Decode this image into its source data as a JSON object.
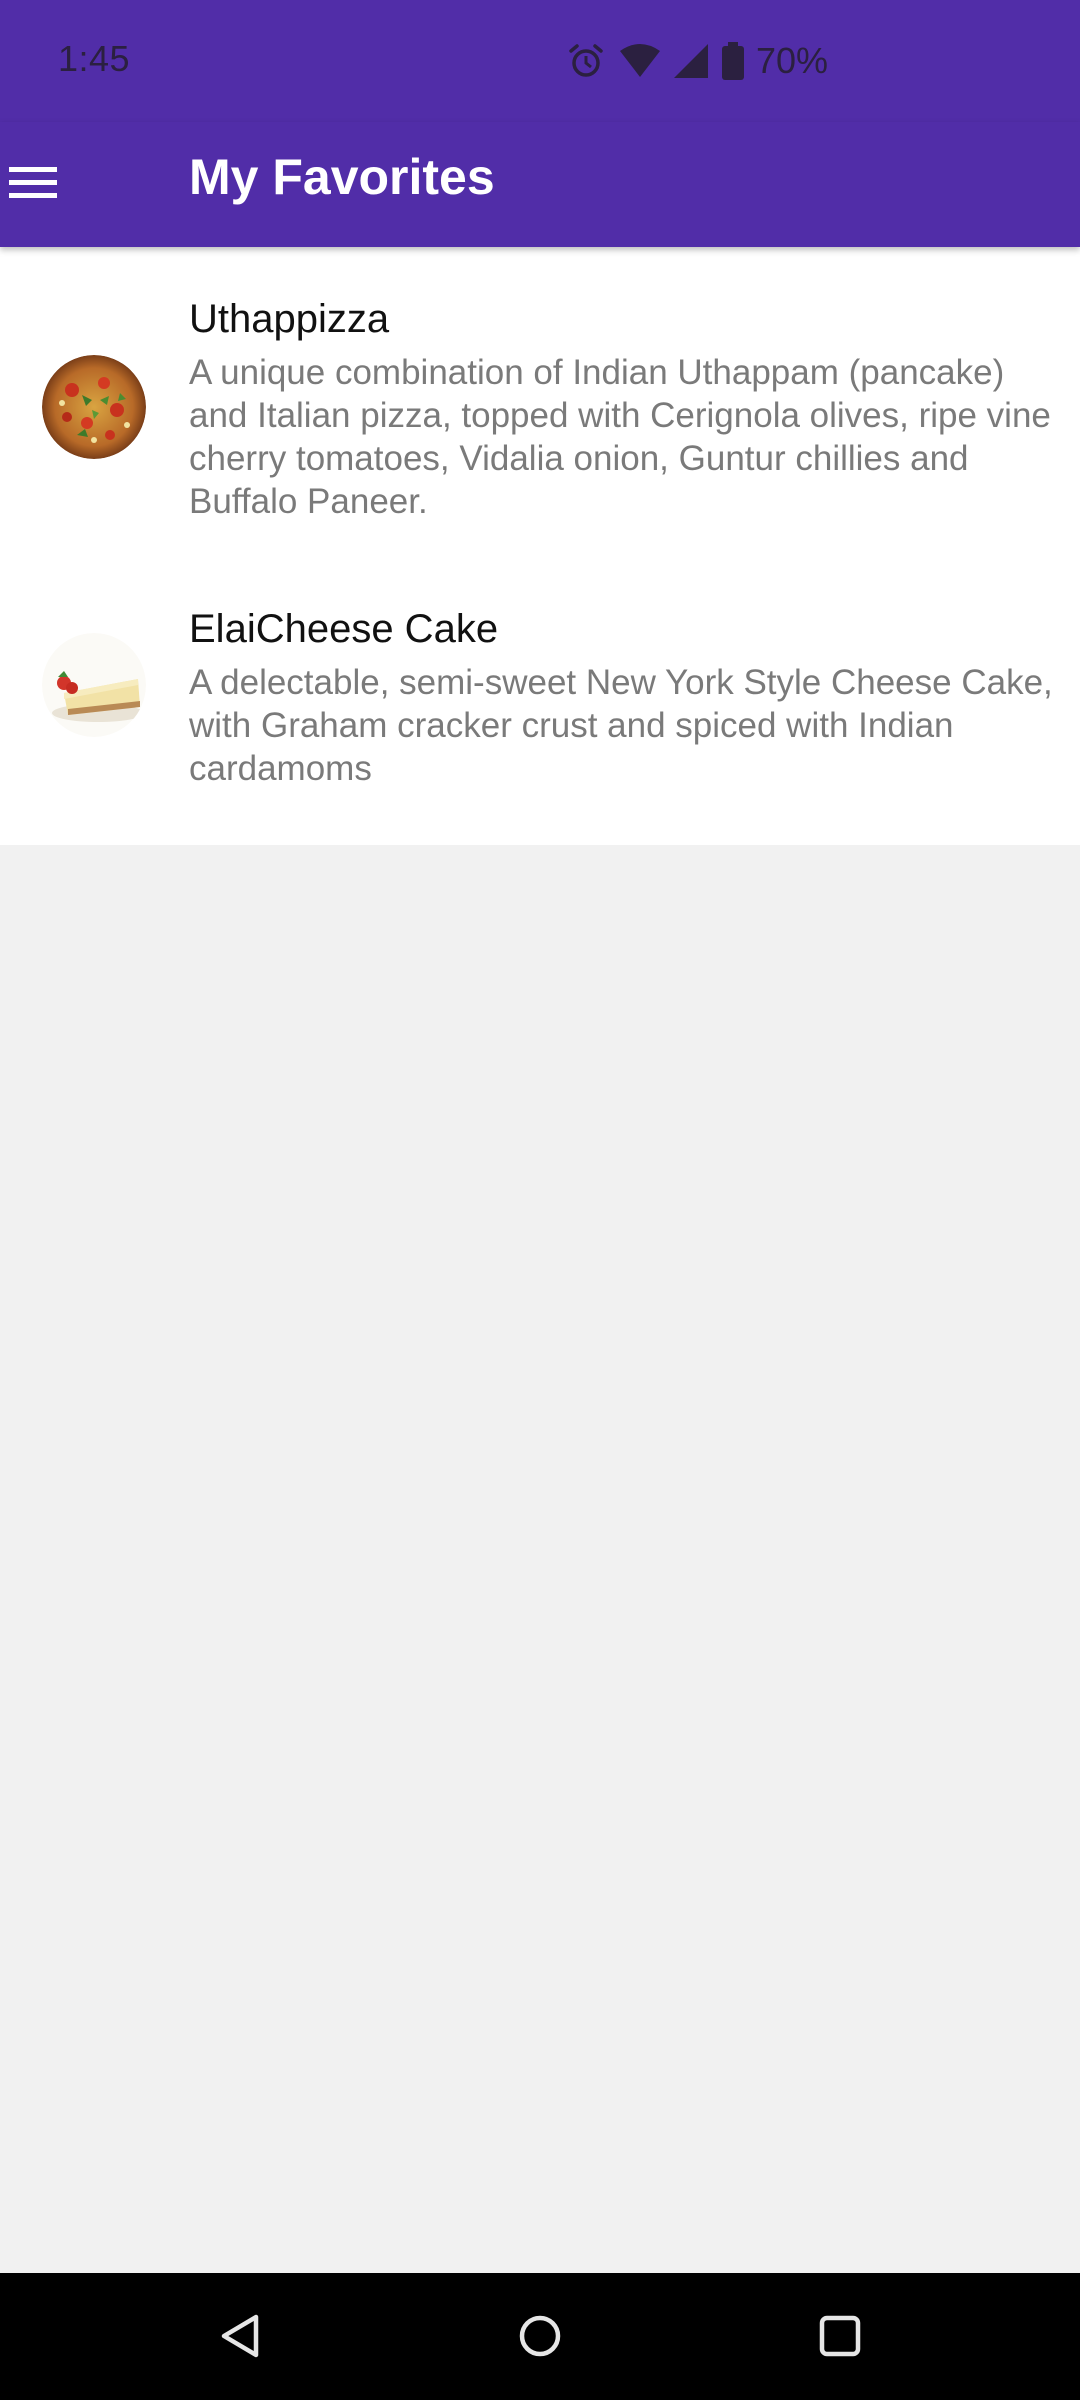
{
  "status_bar": {
    "time": "1:45",
    "battery": "70%",
    "icons": [
      "alarm-icon",
      "wifi-icon",
      "signal-icon",
      "battery-icon"
    ]
  },
  "app_bar": {
    "title": "My Favorites",
    "menu_icon": "hamburger-menu-icon",
    "color": "#512da8"
  },
  "favorites": [
    {
      "title": "Uthappizza",
      "description": "A unique combination of Indian Uthappam (pancake) and Italian pizza, topped with Cerignola olives, ripe vine cherry tomatoes, Vidalia onion, Guntur chillies and Buffalo Paneer.",
      "image": "pizza-image"
    },
    {
      "title": "ElaiCheese Cake",
      "description": "A delectable, semi-sweet New York Style Cheese Cake, with Graham cracker crust and spiced with Indian cardamoms",
      "image": "cheesecake-image"
    }
  ],
  "nav_bar": {
    "icons": [
      "back-icon",
      "home-icon",
      "recents-icon"
    ]
  }
}
